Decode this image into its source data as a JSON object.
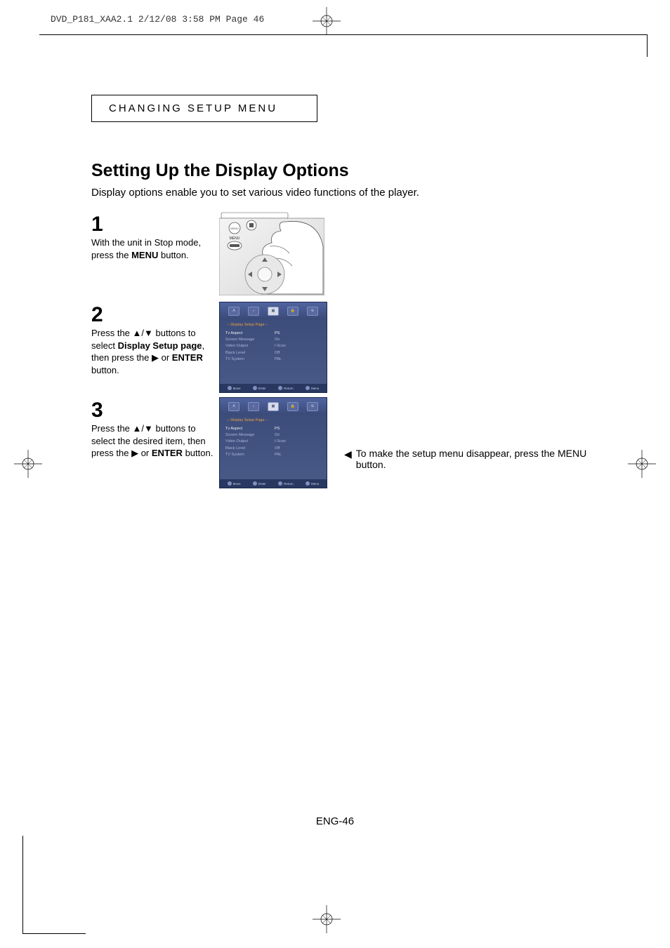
{
  "slug": "DVD_P181_XAA2.1  2/12/08  3:58 PM  Page 46",
  "section_header": "CHANGING SETUP MENU",
  "main_title": "Setting Up the Display Options",
  "intro": "Display options enable you to set various video functions of the player.",
  "steps": {
    "s1": {
      "num": "1",
      "text_before": "With the unit in Stop mode, press the ",
      "bold": "MENU",
      "text_after": " button.",
      "remote_label": "MENU"
    },
    "s2": {
      "num": "2",
      "line1_before": "Press the ",
      "line1_arrows": "▲/▼",
      "line1_after": " buttons to select ",
      "bold1": "Display Setup page",
      "mid": ", then press the ",
      "right_arrow": "▶",
      "or": " or ",
      "bold2": "ENTER",
      "end": " button."
    },
    "s3": {
      "num": "3",
      "line1_before": "Press the ",
      "line1_arrows": "▲/▼",
      "line1_after": " buttons to select the desired item, then press the ",
      "right_arrow": "▶",
      "or": " or ",
      "bold": "ENTER",
      "end": " button."
    }
  },
  "osd": {
    "page_title": "-- Display Setup Page --",
    "rows": [
      {
        "label": "Tv Aspect",
        "value": "PS"
      },
      {
        "label": "Screen Message",
        "value": "On"
      },
      {
        "label": "Video Output",
        "value": "I-Scan"
      },
      {
        "label": "Black Level",
        "value": "Off"
      },
      {
        "label": "TV System",
        "value": "PAL"
      }
    ],
    "footer": {
      "move": "Move",
      "enter": "Enter",
      "return": "Return",
      "menu": "Menu"
    },
    "tab_icons": [
      "A",
      "♪",
      "▦",
      "🔒",
      "⚙"
    ]
  },
  "note": {
    "arrow": "◀",
    "text": "To make the setup menu disappear, press the MENU button."
  },
  "page_number": "ENG-46"
}
